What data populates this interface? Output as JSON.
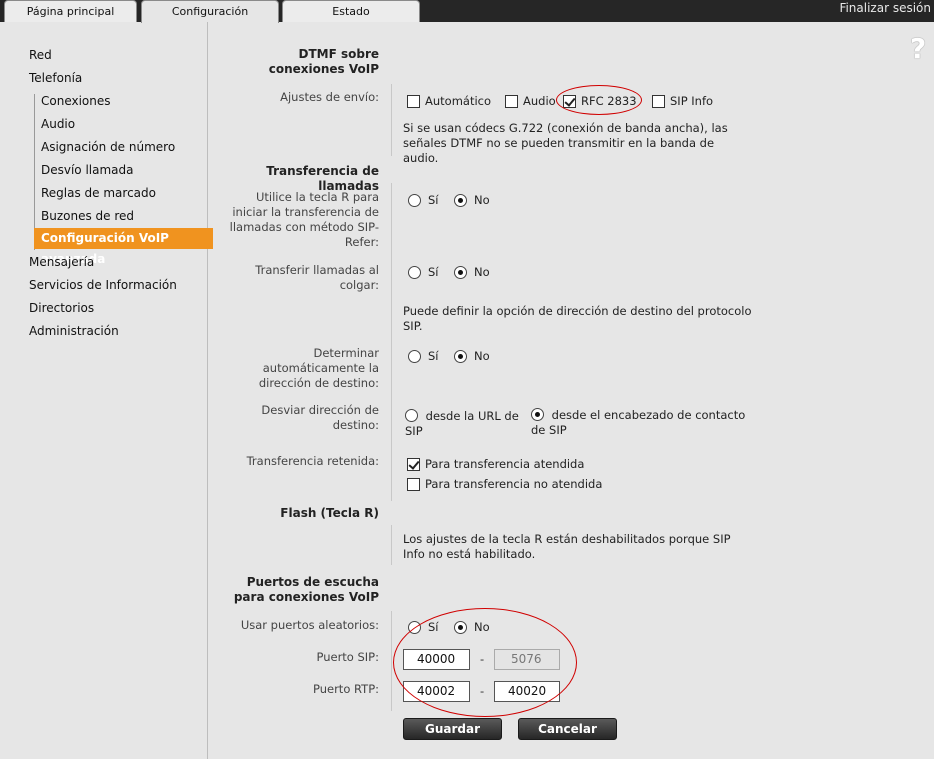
{
  "tabs": {
    "home": "Página principal",
    "config": "Configuración",
    "status": "Estado"
  },
  "logout": "Finalizar sesión",
  "sidebar": {
    "network": "Red",
    "telephony": "Telefonía",
    "connections": "Conexiones",
    "audio": "Audio",
    "number_assignment": "Asignación de número",
    "call_divert": "Desvío llamada",
    "dialing_rules": "Reglas de marcado",
    "network_mailboxes": "Buzones de red",
    "advanced_voip": "Configuración VoIP avanzada",
    "messaging": "Mensajería",
    "info_services": "Servicios de Información",
    "directories": "Directorios",
    "administration": "Administración"
  },
  "help_icon": "?",
  "dtmf": {
    "title": "DTMF sobre conexiones VoIP",
    "send_label": "Ajustes de envío:",
    "options": [
      "Automático",
      "Audio",
      "RFC 2833",
      "SIP Info"
    ],
    "note": "Si se usan códecs G.722 (conexión de banda ancha), las señales DTMF no se pueden transmitir en la banda de audio."
  },
  "transfer": {
    "title": "Transferencia de llamadas",
    "r_key_label": "Utilice la tecla R para iniciar la transferencia de llamadas con método SIP-Refer:",
    "on_hangup_label": "Transferir llamadas al colgar:",
    "dest_note": "Puede definir la opción de dirección de destino del protocolo SIP.",
    "auto_dest_label": "Determinar automáticamente la dirección de destino:",
    "divert_label": "Desviar dirección de destino:",
    "divert_url": "desde la URL de SIP",
    "divert_header": "desde el encabezado de contacto de SIP",
    "held_label": "Transferencia retenida:",
    "attended": "Para transferencia atendida",
    "unattended": "Para transferencia no atendida",
    "yes": "Sí",
    "no": "No"
  },
  "flash": {
    "title": "Flash (Tecla R)",
    "note": "Los ajustes de la tecla R están deshabilitados porque SIP Info no está habilitado."
  },
  "ports": {
    "title": "Puertos de escucha para conexiones VoIP",
    "random_label": "Usar puertos aleatorios:",
    "sip_label": "Puerto SIP:",
    "rtp_label": "Puerto RTP:",
    "sip_from": "40000",
    "sip_to": "5076",
    "rtp_from": "40002",
    "rtp_to": "40020",
    "dash": "-"
  },
  "buttons": {
    "save": "Guardar",
    "cancel": "Cancelar"
  },
  "colors": {
    "accent": "#f0931f",
    "annotation": "#d00000",
    "topbar": "#262626"
  }
}
